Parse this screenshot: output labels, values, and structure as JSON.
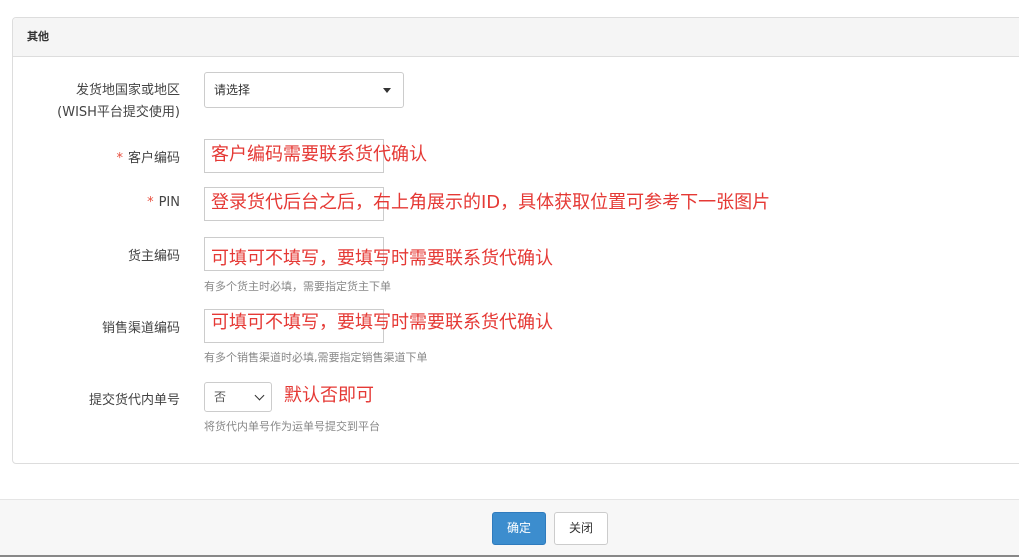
{
  "panel": {
    "title": "其他"
  },
  "form": {
    "origin": {
      "label_line1": "发货地国家或地区",
      "label_line2": "(WISH平台提交使用)",
      "value": "请选择"
    },
    "customer_code": {
      "required_mark": "*",
      "label": "客户编码",
      "annotation": "客户编码需要联系货代确认"
    },
    "pin": {
      "required_mark": "*",
      "label": "PIN",
      "annotation": "登录货代后台之后，右上角展示的ID，具体获取位置可参考下一张图片"
    },
    "shipper_code": {
      "label": "货主编码",
      "annotation": "可填可不填写，要填写时需要联系货代确认",
      "help": "有多个货主时必填，需要指定货主下单"
    },
    "sales_channel_code": {
      "label": "销售渠道编码",
      "annotation": "可填可不填写，要填写时需要联系货代确认",
      "help": "有多个销售渠道时必填,需要指定销售渠道下单"
    },
    "submit_internal_no": {
      "label": "提交货代内单号",
      "value": "否",
      "annotation": "默认否即可",
      "help": "将货代内单号作为运单号提交到平台"
    }
  },
  "footer": {
    "confirm_label": "确定",
    "close_label": "关闭"
  },
  "colors": {
    "primary": "#3c8dce",
    "annotation": "#e53935",
    "required": "#e74c3c"
  }
}
